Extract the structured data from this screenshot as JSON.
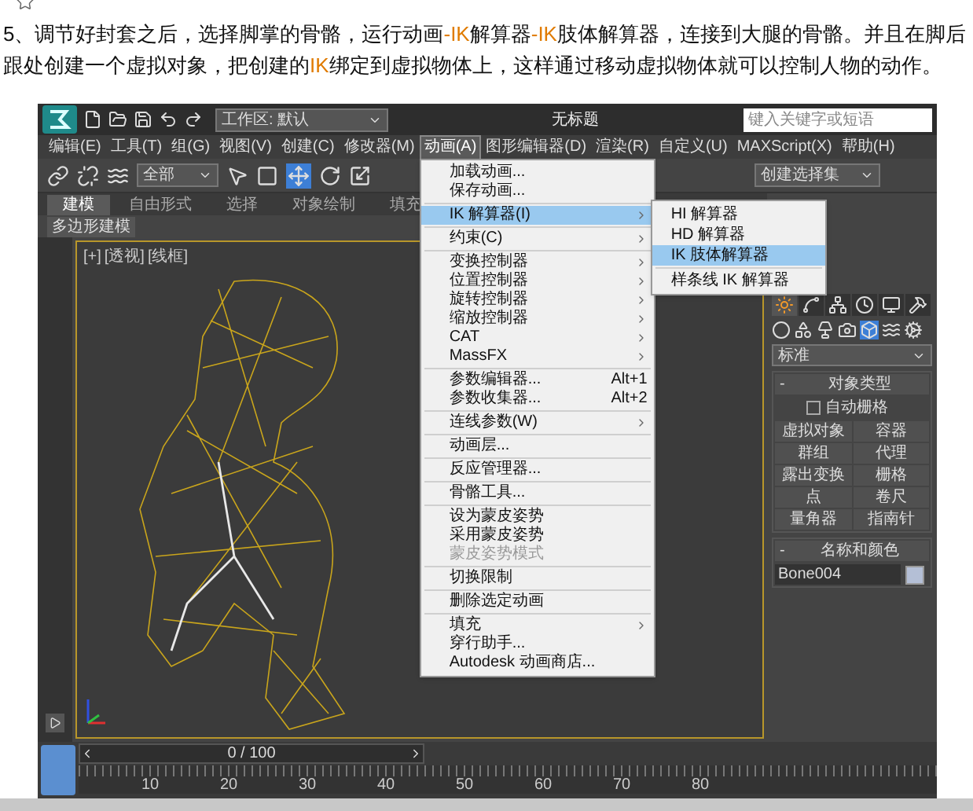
{
  "article": {
    "segments": [
      {
        "text": "5、调节好封套之后，选择脚掌的骨骼，运行动画",
        "highlighted": false
      },
      {
        "text": "-IK",
        "highlighted": true
      },
      {
        "text": "解算器",
        "highlighted": false
      },
      {
        "text": "-IK",
        "highlighted": true
      },
      {
        "text": "肢体解算器，连接到大腿的骨骼。并且在脚后跟处创建一个虚拟对象，把创建的",
        "highlighted": false
      },
      {
        "text": "IK",
        "highlighted": true
      },
      {
        "text": "绑定到虚拟物体上，这样通过移动虚拟物体就可以控制人物的动作。",
        "highlighted": false
      }
    ]
  },
  "app": {
    "workspace": "工作区: 默认",
    "title": "无标题",
    "search": {
      "placeholder": "键入关键字或短语"
    },
    "menus": [
      {
        "label": "编辑(E)",
        "selected": false
      },
      {
        "label": "工具(T)",
        "selected": false
      },
      {
        "label": "组(G)",
        "selected": false
      },
      {
        "label": "视图(V)",
        "selected": false
      },
      {
        "label": "创建(C)",
        "selected": false
      },
      {
        "label": "修改器(M)",
        "selected": false
      },
      {
        "label": "动画(A)",
        "selected": true
      },
      {
        "label": "图形编辑器(D)",
        "selected": false
      },
      {
        "label": "渲染(R)",
        "selected": false
      },
      {
        "label": "自定义(U)",
        "selected": false
      },
      {
        "label": "MAXScript(X)",
        "selected": false
      },
      {
        "label": "帮助(H)",
        "selected": false
      }
    ],
    "selection_filter": "全部",
    "named_selection": "创建选择集",
    "ribbon_tabs": [
      {
        "label": "建模",
        "selected": true
      },
      {
        "label": "自由形式",
        "selected": false
      },
      {
        "label": "选择",
        "selected": false
      },
      {
        "label": "对象绘制",
        "selected": false
      },
      {
        "label": "填充",
        "selected": false
      }
    ],
    "ribbon_panel": "多边形建模",
    "viewport_labels": [
      "[+]",
      "[透视]",
      "[线框]"
    ],
    "animation_menu": [
      {
        "kind": "item",
        "label": "加载动画...",
        "has_submenu": false,
        "selected": false,
        "disabled": false
      },
      {
        "kind": "item",
        "label": "保存动画...",
        "has_submenu": false,
        "selected": false,
        "disabled": false
      },
      {
        "kind": "separator"
      },
      {
        "kind": "item",
        "label": "IK 解算器(I)",
        "has_submenu": true,
        "selected": true,
        "disabled": false
      },
      {
        "kind": "separator"
      },
      {
        "kind": "item",
        "label": "约束(C)",
        "has_submenu": true,
        "selected": false,
        "disabled": false
      },
      {
        "kind": "separator"
      },
      {
        "kind": "item",
        "label": "变换控制器",
        "has_submenu": true,
        "selected": false,
        "disabled": false
      },
      {
        "kind": "item",
        "label": "位置控制器",
        "has_submenu": true,
        "selected": false,
        "disabled": false
      },
      {
        "kind": "item",
        "label": "旋转控制器",
        "has_submenu": true,
        "selected": false,
        "disabled": false
      },
      {
        "kind": "item",
        "label": "缩放控制器",
        "has_submenu": true,
        "selected": false,
        "disabled": false
      },
      {
        "kind": "item",
        "label": "CAT",
        "has_submenu": true,
        "selected": false,
        "disabled": false
      },
      {
        "kind": "item",
        "label": "MassFX",
        "has_submenu": true,
        "selected": false,
        "disabled": false
      },
      {
        "kind": "separator"
      },
      {
        "kind": "item",
        "label": "参数编辑器...",
        "shortcut": "Alt+1",
        "has_submenu": false,
        "selected": false,
        "disabled": false
      },
      {
        "kind": "item",
        "label": "参数收集器...",
        "shortcut": "Alt+2",
        "has_submenu": false,
        "selected": false,
        "disabled": false
      },
      {
        "kind": "separator"
      },
      {
        "kind": "item",
        "label": "连线参数(W)",
        "has_submenu": true,
        "selected": false,
        "disabled": false
      },
      {
        "kind": "separator"
      },
      {
        "kind": "item",
        "label": "动画层...",
        "has_submenu": false,
        "selected": false,
        "disabled": false
      },
      {
        "kind": "separator"
      },
      {
        "kind": "item",
        "label": "反应管理器...",
        "has_submenu": false,
        "selected": false,
        "disabled": false
      },
      {
        "kind": "separator"
      },
      {
        "kind": "item",
        "label": "骨骼工具...",
        "has_submenu": false,
        "selected": false,
        "disabled": false
      },
      {
        "kind": "separator"
      },
      {
        "kind": "item",
        "label": "设为蒙皮姿势",
        "has_submenu": false,
        "selected": false,
        "disabled": false
      },
      {
        "kind": "item",
        "label": "采用蒙皮姿势",
        "has_submenu": false,
        "selected": false,
        "disabled": false
      },
      {
        "kind": "item",
        "label": "蒙皮姿势模式",
        "has_submenu": false,
        "selected": false,
        "disabled": true
      },
      {
        "kind": "separator"
      },
      {
        "kind": "item",
        "label": "切换限制",
        "has_submenu": false,
        "selected": false,
        "disabled": false
      },
      {
        "kind": "separator"
      },
      {
        "kind": "item",
        "label": "删除选定动画",
        "has_submenu": false,
        "selected": false,
        "disabled": false
      },
      {
        "kind": "separator"
      },
      {
        "kind": "item",
        "label": "填充",
        "has_submenu": true,
        "selected": false,
        "disabled": false
      },
      {
        "kind": "item",
        "label": "穿行助手...",
        "has_submenu": false,
        "selected": false,
        "disabled": false
      },
      {
        "kind": "item",
        "label": "Autodesk 动画商店...",
        "has_submenu": false,
        "selected": false,
        "disabled": false
      }
    ],
    "ik_submenu": [
      {
        "kind": "item",
        "label": "HI 解算器",
        "selected": false
      },
      {
        "kind": "item",
        "label": "HD 解算器",
        "selected": false
      },
      {
        "kind": "item",
        "label": "IK 肢体解算器",
        "selected": true
      },
      {
        "kind": "separator"
      },
      {
        "kind": "item",
        "label": "样条线 IK 解算器",
        "selected": false
      }
    ],
    "command_panel": {
      "category": "标准",
      "object_type": {
        "sign": "-",
        "title": "对象类型",
        "autogrid": {
          "label": "自动栅格",
          "checked": false
        },
        "buttons": [
          "虚拟对象",
          "容器",
          "群组",
          "代理",
          "露出变换",
          "栅格",
          "点",
          "卷尺",
          "量角器",
          "指南针"
        ]
      },
      "name_and_color": {
        "sign": "-",
        "title": "名称和颜色",
        "name": "Bone004",
        "color": "#b4bfd6"
      }
    },
    "timeline": {
      "frame": "0 / 100",
      "level": 0,
      "ticks": [
        "10",
        "20",
        "30",
        "40",
        "50",
        "60",
        "70",
        "80"
      ]
    }
  }
}
